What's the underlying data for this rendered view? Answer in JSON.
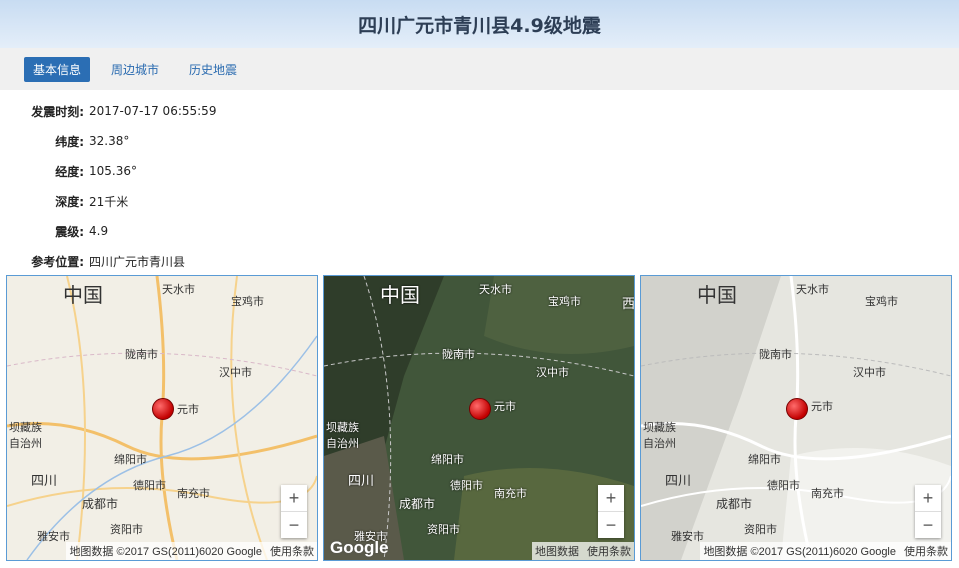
{
  "title": "四川广元市青川县4.9级地震",
  "tabs": [
    {
      "label": "基本信息",
      "active": true
    },
    {
      "label": "周边城市",
      "active": false
    },
    {
      "label": "历史地震",
      "active": false
    }
  ],
  "info": [
    {
      "label": "发震时刻:",
      "value": "2017-07-17 06:55:59"
    },
    {
      "label": "纬度:",
      "value": "32.38°"
    },
    {
      "label": "经度:",
      "value": "105.36°"
    },
    {
      "label": "深度:",
      "value": "21千米"
    },
    {
      "label": "震级:",
      "value": "4.9"
    },
    {
      "label": "参考位置:",
      "value": "四川广元市青川县"
    }
  ],
  "map_labels": {
    "country": "中国",
    "tianshui": "天水市",
    "baoji": "宝鸡市",
    "longnan": "陇南市",
    "hanzhong": "汉中市",
    "guangyuan": "元市",
    "aba": "坝藏族\n自治州",
    "mianyang": "绵阳市",
    "deyang": "德阳市",
    "sichuan": "四川",
    "chengdu": "成都市",
    "nanchong": "南充市",
    "ziyang": "资阳市",
    "yaan": "雅安市",
    "xi": "西"
  },
  "maps": [
    {
      "type": "road",
      "attribution": "地图数据 ©2017 GS(2011)6020 Google",
      "terms": "使用条款"
    },
    {
      "type": "satellite",
      "attribution": "地图数据",
      "terms": "使用条款",
      "logo": "Google"
    },
    {
      "type": "terrain",
      "attribution": "地图数据 ©2017 GS(2011)6020 Google",
      "terms": "使用条款"
    }
  ],
  "zoom": {
    "plus": "+",
    "minus": "−"
  }
}
